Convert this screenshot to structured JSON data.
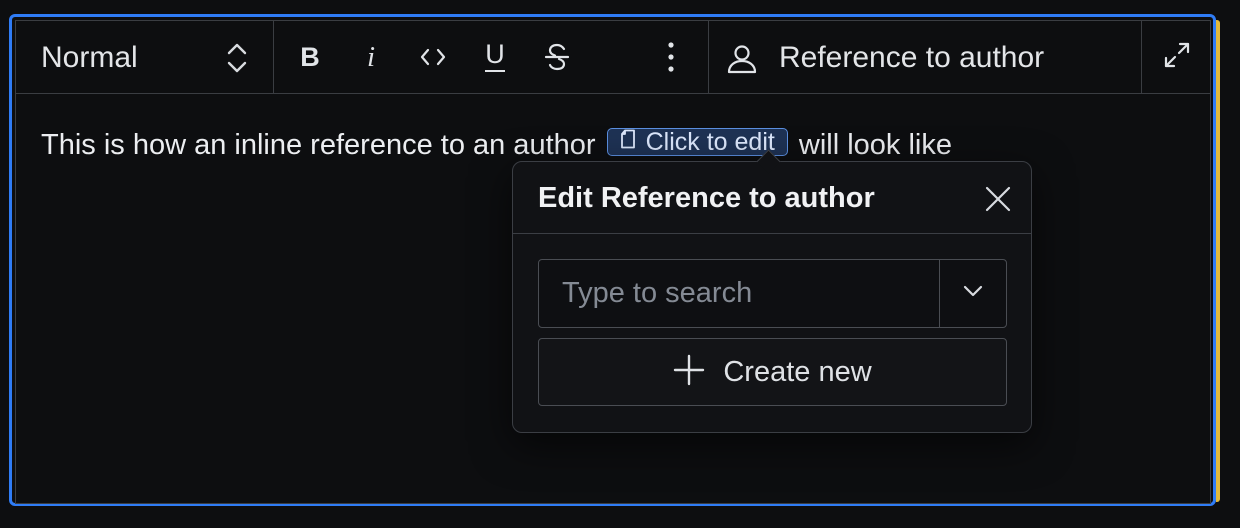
{
  "toolbar": {
    "style_select_value": "Normal",
    "bold_label": "B",
    "italic_label": "i",
    "underline_label": "U",
    "reference_label": "Reference to author",
    "icons": {
      "style": "chevron-up-down-icon",
      "code": "code-icon",
      "strike": "strikethrough-icon",
      "more": "more-vertical-icon",
      "reference": "person-icon",
      "expand": "expand-icon"
    }
  },
  "content": {
    "text_before": "This is how an inline reference to an author",
    "inline_ref_label": "Click to edit",
    "text_after": "will look like"
  },
  "popover": {
    "title": "Edit Reference to author",
    "search_placeholder": "Type to search",
    "search_value": "",
    "create_label": "Create new"
  },
  "colors": {
    "focus_border": "#2f7cf6",
    "side_indicator": "#e2b93b",
    "inline_ref_bg": "#1e3254",
    "inline_ref_border": "#5b8fe0"
  }
}
